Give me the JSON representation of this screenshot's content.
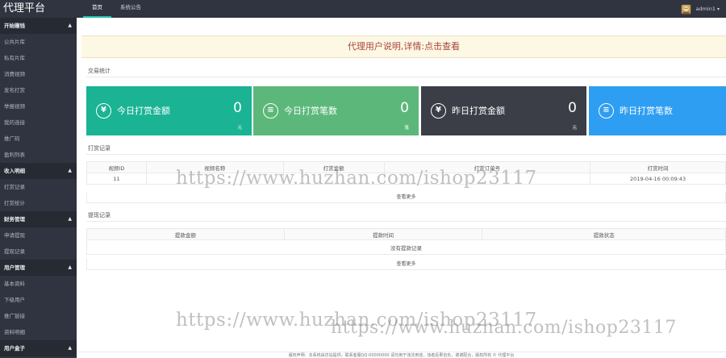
{
  "app": {
    "title": "代理平台"
  },
  "topnav": {
    "items": [
      "首页",
      "系统公告"
    ],
    "active": 0
  },
  "user": {
    "name": "admin1"
  },
  "sidebar": {
    "groups": [
      {
        "title": "开始赚钱",
        "items": [
          "公共片库",
          "私有片库",
          "消费视频",
          "发布打赏",
          "举报视频",
          "我的连接",
          "推广码",
          "盈利列表"
        ]
      },
      {
        "title": "收入明细",
        "items": [
          "打赏记录",
          "打赏统计"
        ]
      },
      {
        "title": "财务管理",
        "items": [
          "申请提现",
          "提现记录"
        ]
      },
      {
        "title": "用户管理",
        "items": [
          "基本资料",
          "下级用户",
          "推广链接",
          "资料明细"
        ]
      },
      {
        "title": "用户盒子",
        "items": []
      }
    ]
  },
  "notice": {
    "text": "代理用户说明,详情:点击查看"
  },
  "stats": {
    "title": "交易统计",
    "cards": [
      {
        "label": "今日打赏金额",
        "value": "0",
        "unit": "元",
        "color": "#1ab394"
      },
      {
        "label": "今日打赏笔数",
        "value": "0",
        "unit": "笔",
        "color": "#5cb87a"
      },
      {
        "label": "昨日打赏金额",
        "value": "0",
        "unit": "元",
        "color": "#3b3e47"
      },
      {
        "label": "昨日打赏笔数",
        "value": "",
        "unit": "",
        "color": "#2e9ef2"
      }
    ]
  },
  "tips": {
    "title": "打赏记录",
    "columns": [
      "视频ID",
      "视频名称",
      "打赏金额",
      "打赏订单号",
      "打赏时间"
    ],
    "rows": [
      [
        "11",
        "",
        "",
        "",
        "2019-04-16 00:09:43"
      ]
    ],
    "more": "查看更多"
  },
  "withdraw": {
    "title": "提现记录",
    "columns": [
      "提款金额",
      "提款时间",
      "提款状态"
    ],
    "empty": "没有提款记录",
    "more": "查看更多"
  },
  "watermarks": [
    "https://www.huzhan.com/ishop23117",
    "https://www.huzhan.com/ishop23117",
    "https://www.huzhan.com/ishop23117"
  ],
  "footer": {
    "text": "版权声明：本系统由仿站提供，联系客服QQ:00000000 请勿用于违法用途，违者后果自负，谢谢配合，版权所有 © 代理平台"
  }
}
